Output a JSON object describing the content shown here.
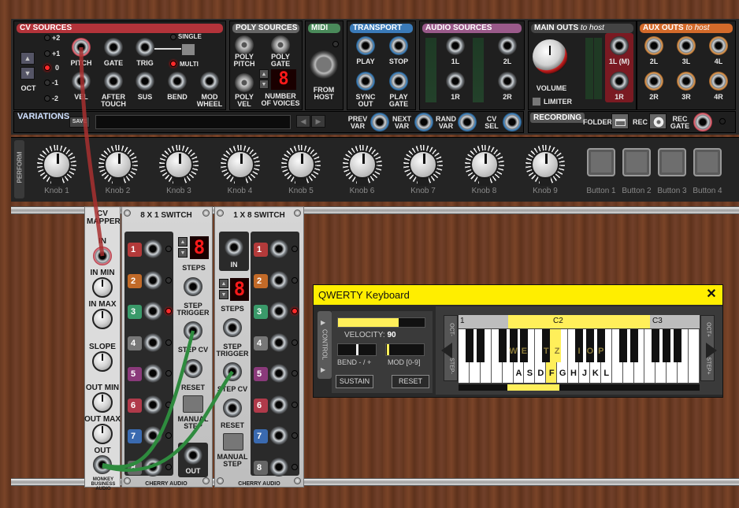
{
  "cv_sources": {
    "title": "CV SOURCES",
    "oct_label": "OCT",
    "oct_levels": [
      "+2",
      "+1",
      "0",
      "-1",
      "-2"
    ],
    "pitch": "PITCH",
    "gate": "GATE",
    "trig": "TRIG",
    "single": "SINGLE",
    "multi": "MULTI",
    "vel": "VEL",
    "after_touch": "AFTER TOUCH",
    "sus": "SUS",
    "bend": "BEND",
    "mod_wheel": "MOD WHEEL"
  },
  "poly_sources": {
    "title": "POLY SOURCES",
    "poly_pitch": "POLY PITCH",
    "poly_gate": "POLY GATE",
    "poly_vel": "POLY VEL",
    "num_voices": "NUMBER OF VOICES",
    "voices_value": "8"
  },
  "midi": {
    "title": "MIDI",
    "from_host": "FROM HOST"
  },
  "transport": {
    "title": "TRANSPORT",
    "play": "PLAY",
    "stop": "STOP",
    "sync_out": "SYNC OUT",
    "play_gate": "PLAY GATE"
  },
  "audio_sources": {
    "title": "AUDIO SOURCES",
    "l1": "1L",
    "l2": "2L",
    "r1": "1R",
    "r2": "2R"
  },
  "main_outs": {
    "title": "MAIN OUTS",
    "title_suffix": "to host",
    "volume": "VOLUME",
    "limiter": "LIMITER",
    "l1m": "1L (M)",
    "r1": "1R"
  },
  "aux_outs": {
    "title": "AUX OUTS",
    "title_suffix": "to host",
    "l2": "2L",
    "l3": "3L",
    "l4": "4L",
    "r2": "2R",
    "r3": "3R",
    "r4": "4R"
  },
  "variations": {
    "title": "VARIATIONS",
    "save": "SAVE",
    "prev_var": "PREV VAR",
    "next_var": "NEXT VAR",
    "rand_var": "RAND VAR",
    "cv_sel": "CV SEL"
  },
  "recording": {
    "title": "RECORDING",
    "folder": "FOLDER",
    "rec": "REC",
    "rec_gate": "REC GATE"
  },
  "perform": {
    "title": "PERFORM",
    "knobs": [
      "Knob 1",
      "Knob 2",
      "Knob 3",
      "Knob 4",
      "Knob 5",
      "Knob 6",
      "Knob 7",
      "Knob 8",
      "Knob 9"
    ],
    "buttons": [
      "Button 1",
      "Button 2",
      "Button 3",
      "Button 4"
    ]
  },
  "cv_mapper": {
    "title": "CV MAPPER",
    "in": "IN",
    "in_min": "IN MIN",
    "in_max": "IN MAX",
    "slope": "SLOPE",
    "out_min": "OUT MIN",
    "out_max": "OUT MAX",
    "out": "OUT",
    "brand": "MONKEY BUSINESS AUDIO"
  },
  "switch8x1": {
    "title": "8 X 1 SWITCH",
    "steps_value": "8",
    "steps": "STEPS",
    "step_trigger": "STEP TRIGGER",
    "step_cv": "STEP CV",
    "reset": "RESET",
    "manual_step": "MANUAL STEP",
    "out": "OUT",
    "numbers": [
      "1",
      "2",
      "3",
      "4",
      "5",
      "6",
      "7",
      "8"
    ],
    "brand": "CHERRY AUDIO"
  },
  "switch1x8": {
    "title": "1 X 8 SWITCH",
    "in": "IN",
    "steps_value": "8",
    "steps": "STEPS",
    "step_trigger": "STEP TRIGGER",
    "step_cv": "STEP CV",
    "reset": "RESET",
    "manual_step": "MANUAL STEP",
    "numbers": [
      "1",
      "2",
      "3",
      "4",
      "5",
      "6",
      "7",
      "8"
    ],
    "brand": "CHERRY AUDIO"
  },
  "qwerty": {
    "title": "QWERTY Keyboard",
    "close": "✕",
    "control": "CONTROL",
    "velocity_label": "VELOCITY:",
    "velocity_value": "90",
    "velocity": 0.7,
    "bend": "BEND - / +",
    "mod": "MOD [0-9]",
    "sustain": "SUSTAIN",
    "reset": "RESET",
    "oct_minus": "OCT-",
    "oct_plus": "OCT+",
    "step_minus": "STEP-",
    "step_plus": "STEP+",
    "octave_labels": [
      "1",
      "C2",
      "C3"
    ],
    "upper_letters": [
      "W",
      "E",
      "T",
      "Z",
      "I",
      "O",
      "P"
    ],
    "lower_letters": [
      "A",
      "S",
      "D",
      "F",
      "G",
      "H",
      "J",
      "K",
      "L"
    ]
  },
  "colors": {
    "cv_header": "#b3333a",
    "poly_header": "#666666",
    "midi_header": "#4a8a5a",
    "transport_header": "#3a7ab8",
    "audio_header": "#9a5a8a",
    "aux_header": "#d36a2a",
    "qwerty_bar": "#ffee00",
    "patch_cable": "#b03030",
    "green_cable": "#2e8b3e"
  }
}
